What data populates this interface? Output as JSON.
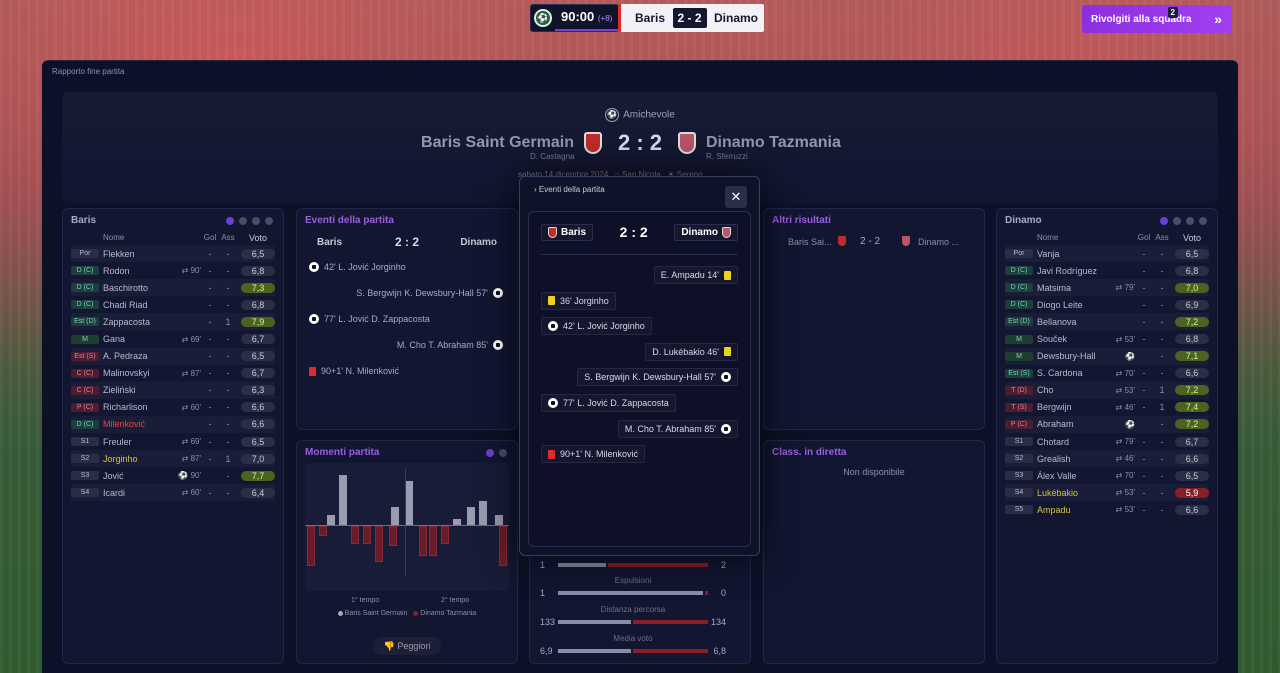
{
  "hud": {
    "time": "90:00",
    "added": "(+8)",
    "home": "Baris",
    "score": "2 - 2",
    "away": "Dinamo",
    "back": "Rivolgiti alla squadra",
    "inbox": "2"
  },
  "breadcrumb": "Rapporto fine partita",
  "match": {
    "competition": "Amichevole",
    "home": "Baris Saint Germain",
    "away": "Dinamo Tazmania",
    "score": "2 : 2",
    "home_coach": "D. Castagna",
    "away_coach": "R. Sferruzzi",
    "date": "sabato 14 dicembre 2024",
    "venue": "San Nicola",
    "weather": "Sereno"
  },
  "left_team": {
    "title": "Baris",
    "cols": {
      "name": "Nome",
      "gol": "Gol",
      "ass": "Ass",
      "voto": "Voto"
    },
    "players": [
      {
        "pos": "Por",
        "cls": "p-gk",
        "name": "Flekken",
        "sub": "",
        "gol": "-",
        "ass": "-",
        "voto": "6,5",
        "vc": ""
      },
      {
        "pos": "D (C)",
        "cls": "p-d",
        "name": "Rodon",
        "sub": "⇄ 90'",
        "gol": "-",
        "ass": "-",
        "voto": "6,8",
        "vc": ""
      },
      {
        "pos": "D (C)",
        "cls": "p-d",
        "name": "Baschirotto",
        "sub": "",
        "gol": "-",
        "ass": "-",
        "voto": "7,3",
        "vc": "v-good"
      },
      {
        "pos": "D (C)",
        "cls": "p-d",
        "name": "Chadi Riad",
        "sub": "",
        "gol": "-",
        "ass": "-",
        "voto": "6,8",
        "vc": ""
      },
      {
        "pos": "Est (D)",
        "cls": "p-d",
        "name": "Zappacosta",
        "sub": "",
        "gol": "-",
        "ass": "1",
        "voto": "7,9",
        "vc": "v-good"
      },
      {
        "pos": "M",
        "cls": "p-m",
        "name": "Gana",
        "sub": "⇄ 69'",
        "gol": "-",
        "ass": "-",
        "voto": "6,7",
        "vc": ""
      },
      {
        "pos": "Est (S)",
        "cls": "p-a",
        "name": "A. Pedraza",
        "sub": "",
        "gol": "-",
        "ass": "-",
        "voto": "6,5",
        "vc": ""
      },
      {
        "pos": "C (C)",
        "cls": "p-a",
        "name": "Malinovskyi",
        "sub": "⇄ 87'",
        "gol": "-",
        "ass": "-",
        "voto": "6,7",
        "vc": ""
      },
      {
        "pos": "C (C)",
        "cls": "p-a",
        "name": "Zieliński",
        "sub": "",
        "gol": "-",
        "ass": "-",
        "voto": "6,3",
        "vc": ""
      },
      {
        "pos": "P (C)",
        "cls": "p-a",
        "name": "Richarlison",
        "sub": "⇄ 60'",
        "gol": "-",
        "ass": "-",
        "voto": "6,6",
        "vc": ""
      },
      {
        "pos": "D (C)",
        "cls": "p-d",
        "name": "Milenković",
        "sub": "",
        "gol": "-",
        "ass": "-",
        "voto": "6,6",
        "vc": "",
        "hl": "hl-r"
      },
      {
        "pos": "S1",
        "cls": "p-s",
        "name": "Freuler",
        "sub": "⇄ 69'",
        "gol": "-",
        "ass": "-",
        "voto": "6,5",
        "vc": ""
      },
      {
        "pos": "S2",
        "cls": "p-s",
        "name": "Jorginho",
        "sub": "⇄ 87'",
        "gol": "-",
        "ass": "1",
        "voto": "7,0",
        "vc": "",
        "hl": "hl-y"
      },
      {
        "pos": "S3",
        "cls": "p-s",
        "name": "Jović",
        "sub": "⚽ 90'",
        "gol": "",
        "ass": "-",
        "voto": "7,7",
        "vc": "v-good"
      },
      {
        "pos": "S4",
        "cls": "p-s",
        "name": "Icardi",
        "sub": "⇄ 60'",
        "gol": "-",
        "ass": "-",
        "voto": "6,4",
        "vc": ""
      }
    ]
  },
  "right_team": {
    "title": "Dinamo",
    "cols": {
      "name": "Nome",
      "gol": "Gol",
      "ass": "Ass",
      "voto": "Voto"
    },
    "players": [
      {
        "pos": "Por",
        "cls": "p-gk",
        "name": "Vanja",
        "sub": "",
        "gol": "-",
        "ass": "-",
        "voto": "6,5",
        "vc": ""
      },
      {
        "pos": "D (C)",
        "cls": "p-d",
        "name": "Javi Rodríguez",
        "sub": "",
        "gol": "-",
        "ass": "-",
        "voto": "6,8",
        "vc": ""
      },
      {
        "pos": "D (C)",
        "cls": "p-d",
        "name": "Matsima",
        "sub": "⇄ 79'",
        "gol": "-",
        "ass": "-",
        "voto": "7,0",
        "vc": "v-good"
      },
      {
        "pos": "D (C)",
        "cls": "p-d",
        "name": "Diogo Leite",
        "sub": "",
        "gol": "-",
        "ass": "-",
        "voto": "6,9",
        "vc": ""
      },
      {
        "pos": "Est (D)",
        "cls": "p-d",
        "name": "Bellanova",
        "sub": "",
        "gol": "-",
        "ass": "-",
        "voto": "7,2",
        "vc": "v-good"
      },
      {
        "pos": "M",
        "cls": "p-m",
        "name": "Souček",
        "sub": "⇄ 53'",
        "gol": "-",
        "ass": "-",
        "voto": "6,8",
        "vc": ""
      },
      {
        "pos": "M",
        "cls": "p-m",
        "name": "Dewsbury-Hall",
        "sub": "⚽",
        "gol": "",
        "ass": "-",
        "voto": "7,1",
        "vc": "v-good"
      },
      {
        "pos": "Est (S)",
        "cls": "p-d",
        "name": "S. Cardona",
        "sub": "⇄ 70'",
        "gol": "-",
        "ass": "-",
        "voto": "6,6",
        "vc": ""
      },
      {
        "pos": "T (D)",
        "cls": "p-a",
        "name": "Cho",
        "sub": "⇄ 53'",
        "gol": "-",
        "ass": "1",
        "voto": "7,2",
        "vc": "v-good"
      },
      {
        "pos": "T (S)",
        "cls": "p-a",
        "name": "Bergwijn",
        "sub": "⇄ 46'",
        "gol": "-",
        "ass": "1",
        "voto": "7,4",
        "vc": "v-good"
      },
      {
        "pos": "P (C)",
        "cls": "p-a",
        "name": "Abraham",
        "sub": "⚽",
        "gol": "",
        "ass": "-",
        "voto": "7,2",
        "vc": "v-good"
      },
      {
        "pos": "S1",
        "cls": "p-s",
        "name": "Chotard",
        "sub": "⇄ 79'",
        "gol": "-",
        "ass": "-",
        "voto": "6,7",
        "vc": ""
      },
      {
        "pos": "S2",
        "cls": "p-s",
        "name": "Grealish",
        "sub": "⇄ 46'",
        "gol": "-",
        "ass": "-",
        "voto": "6,6",
        "vc": ""
      },
      {
        "pos": "S3",
        "cls": "p-s",
        "name": "Álex Valle",
        "sub": "⇄ 70'",
        "gol": "-",
        "ass": "-",
        "voto": "6,5",
        "vc": ""
      },
      {
        "pos": "S4",
        "cls": "p-s",
        "name": "Lukébakio",
        "sub": "⇄ 53'",
        "gol": "-",
        "ass": "-",
        "voto": "5,9",
        "vc": "v-bad",
        "hl": "hl-y"
      },
      {
        "pos": "S5",
        "cls": "p-s",
        "name": "Ampadu",
        "sub": "⇄ 53'",
        "gol": "-",
        "ass": "-",
        "voto": "6,6",
        "vc": "",
        "hl": "hl-y"
      }
    ]
  },
  "events_panel": {
    "title": "Eventi della partita",
    "home": "Baris",
    "away": "Dinamo",
    "score": "2 : 2",
    "items": [
      "42' L. Jović Jorginho",
      "S. Bergwijn K. Dewsbury-Hall 57'",
      "77' L. Jović D. Zappacosta",
      "M. Cho T. Abraham 85'",
      "90+1' N. Milenković"
    ]
  },
  "momenti": {
    "title": "Momenti partita",
    "t1": "1° tempo",
    "t2": "2° tempo",
    "leg_home": "Baris Saint Germain",
    "leg_away": "Dinamo Tazmania",
    "btn": "Peggiori"
  },
  "altri": {
    "title": "Altri risultati",
    "home": "Baris Sai...",
    "score": "2 - 2",
    "away": "Dinamo ..."
  },
  "class": {
    "title": "Class. in diretta",
    "empty": "Non disponibile"
  },
  "stats": [
    {
      "label": "Espulsioni",
      "l": "1",
      "r": "0",
      "p": 1.0
    },
    {
      "label": "Distanza percorsa",
      "l": "133",
      "r": "134",
      "p": 0.5
    },
    {
      "label": "Media voto",
      "l": "6,9",
      "r": "6,8",
      "p": 0.5
    }
  ],
  "stat_top": {
    "l": "1",
    "r": "2",
    "p": 0.33
  },
  "modal": {
    "title": "Eventi della partita",
    "home": "Baris",
    "away": "Dinamo",
    "score": "2 : 2",
    "events": [
      {
        "text": "E. Ampadu 14'",
        "side": "r",
        "icon": "yc"
      },
      {
        "text": "36' Jorginho",
        "side": "l",
        "icon": "yc"
      },
      {
        "text": "42' L. Jović Jorginho",
        "side": "l",
        "icon": "ball"
      },
      {
        "text": "D. Lukébakio 46'",
        "side": "r",
        "icon": "yc"
      },
      {
        "text": "S. Bergwijn K. Dewsbury-Hall 57'",
        "side": "r",
        "icon": "ball"
      },
      {
        "text": "77' L. Jović D. Zappacosta",
        "side": "l",
        "icon": "ball"
      },
      {
        "text": "M. Cho T. Abraham 85'",
        "side": "r",
        "icon": "ball"
      },
      {
        "text": "90+1' N. Milenković",
        "side": "l",
        "icon": "rc"
      }
    ]
  }
}
